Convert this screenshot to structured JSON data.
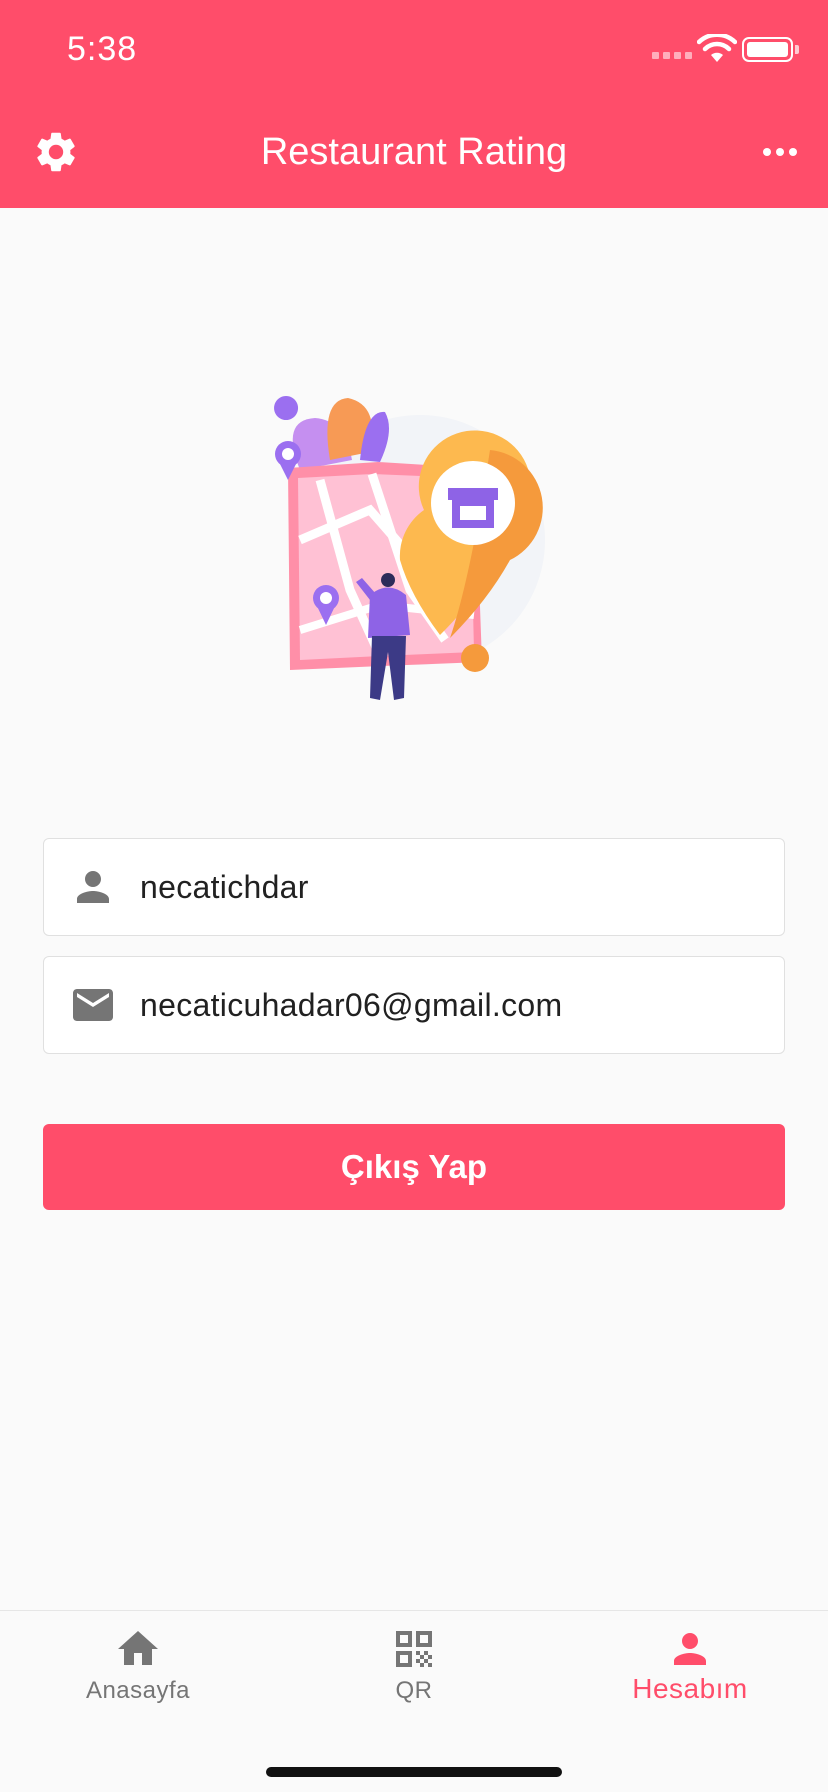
{
  "status_bar": {
    "time": "5:38"
  },
  "app_bar": {
    "title": "Restaurant Rating"
  },
  "profile": {
    "username": "necatichdar",
    "email": "necaticuhadar06@gmail.com"
  },
  "actions": {
    "logout_label": "Çıkış Yap"
  },
  "bottom_nav": {
    "items": [
      {
        "label": "Anasayfa",
        "icon": "home-icon"
      },
      {
        "label": "QR",
        "icon": "qr-code-icon"
      },
      {
        "label": "Hesabım",
        "icon": "person-icon",
        "active": true
      }
    ]
  },
  "colors": {
    "accent": "#ff4d6a",
    "icon_gray": "#757575",
    "background": "#fafafa"
  }
}
